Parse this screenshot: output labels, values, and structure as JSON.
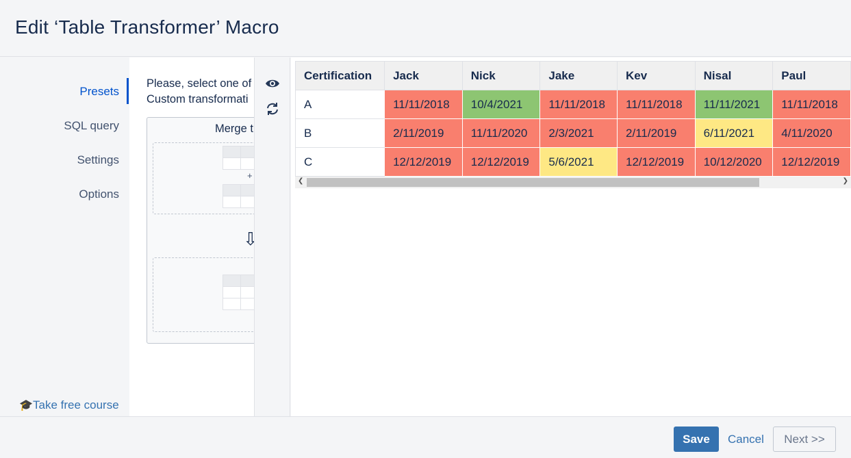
{
  "dialog": {
    "title": "Edit ‘Table Transformer’ Macro"
  },
  "sidebar": {
    "items": [
      {
        "label": "Presets",
        "active": true
      },
      {
        "label": "SQL query",
        "active": false
      },
      {
        "label": "Settings",
        "active": false
      },
      {
        "label": "Options",
        "active": false
      }
    ],
    "course_label": "Take free course"
  },
  "presets": {
    "line1": "Please, select one of",
    "line2": "Custom transformati",
    "card_title": "Merge t",
    "plus": "+"
  },
  "toolbar": {
    "preview_icon": "eye-icon",
    "refresh_icon": "refresh-icon"
  },
  "table": {
    "headers": [
      "Certification",
      "Jack",
      "Nick",
      "Jake",
      "Kev",
      "Nisal",
      "Paul"
    ],
    "rows": [
      {
        "label": "A",
        "cells": [
          "11/11/2018",
          "10/4/2021",
          "11/11/2018",
          "11/11/2018",
          "11/11/2021",
          "11/11/2018"
        ],
        "colors": [
          "red",
          "green",
          "red",
          "red",
          "green",
          "red"
        ]
      },
      {
        "label": "B",
        "cells": [
          "2/11/2019",
          "11/11/2020",
          "2/3/2021",
          "2/11/2019",
          "6/11/2021",
          "4/11/2020"
        ],
        "colors": [
          "red",
          "red",
          "red",
          "red",
          "yellow",
          "red"
        ]
      },
      {
        "label": "C",
        "cells": [
          "12/12/2019",
          "12/12/2019",
          "5/6/2021",
          "12/12/2019",
          "10/12/2020",
          "12/12/2019"
        ],
        "colors": [
          "red",
          "red",
          "yellow",
          "red",
          "red",
          "red"
        ]
      }
    ],
    "status_colors": {
      "red": "#f97f6e",
      "green": "#8dc572",
      "yellow": "#fee884"
    }
  },
  "footer": {
    "save": "Save",
    "cancel": "Cancel",
    "next": "Next >>"
  }
}
